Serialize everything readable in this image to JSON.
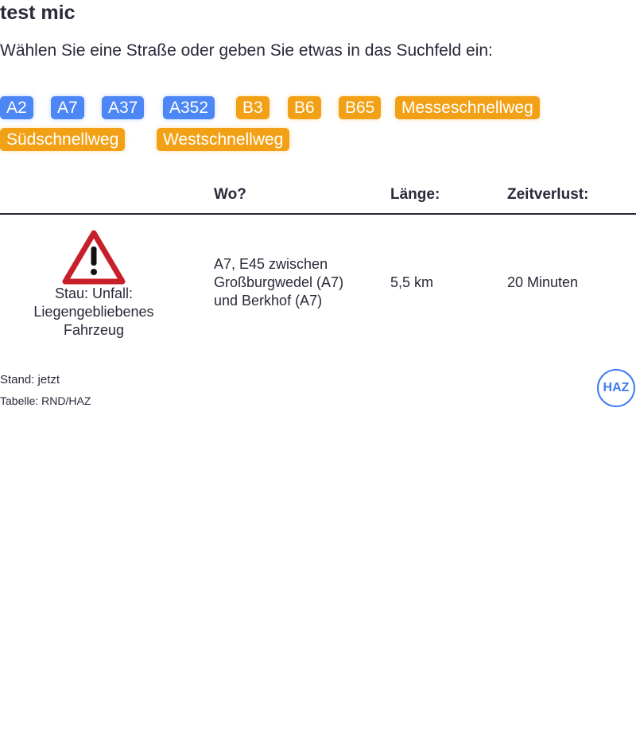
{
  "header": {
    "title": "test mic",
    "subtitle": "Wählen Sie eine Straße oder geben Sie etwas in das Suchfeld ein:"
  },
  "filters": [
    {
      "label": "A2",
      "color": "#4d86f5"
    },
    {
      "label": "A7",
      "color": "#4d86f5"
    },
    {
      "label": "A37",
      "color": "#4d86f5"
    },
    {
      "label": "A352",
      "color": "#4d86f5"
    },
    {
      "label": "B3",
      "color": "#f2a116"
    },
    {
      "label": "B6",
      "color": "#f2a116"
    },
    {
      "label": "B65",
      "color": "#f2a116"
    },
    {
      "label": "Messeschnellweg",
      "color": "#f2a116"
    },
    {
      "label": "Südschnellweg",
      "color": "#f2a116"
    },
    {
      "label": "Westschnellweg",
      "color": "#f2a116"
    }
  ],
  "table": {
    "columns": [
      "",
      "Wo?",
      "Länge:",
      "Zeitverlust:"
    ],
    "rows": [
      {
        "icon": "warning-triangle-icon",
        "type_line1": "Stau: Unfall:",
        "type_line2": "Liegengebliebenes",
        "type_line3": "Fahrzeug",
        "where_line1": "A7, E45 zwischen",
        "where_line2": "Großburgwedel (A7)",
        "where_line3": "und Berkhof (A7)",
        "length": "5,5 km",
        "delay": "20 Minuten"
      }
    ]
  },
  "footer": {
    "stand": "Stand: jetzt",
    "source": "Tabelle: RND/HAZ",
    "logo_text": "HAZ"
  }
}
